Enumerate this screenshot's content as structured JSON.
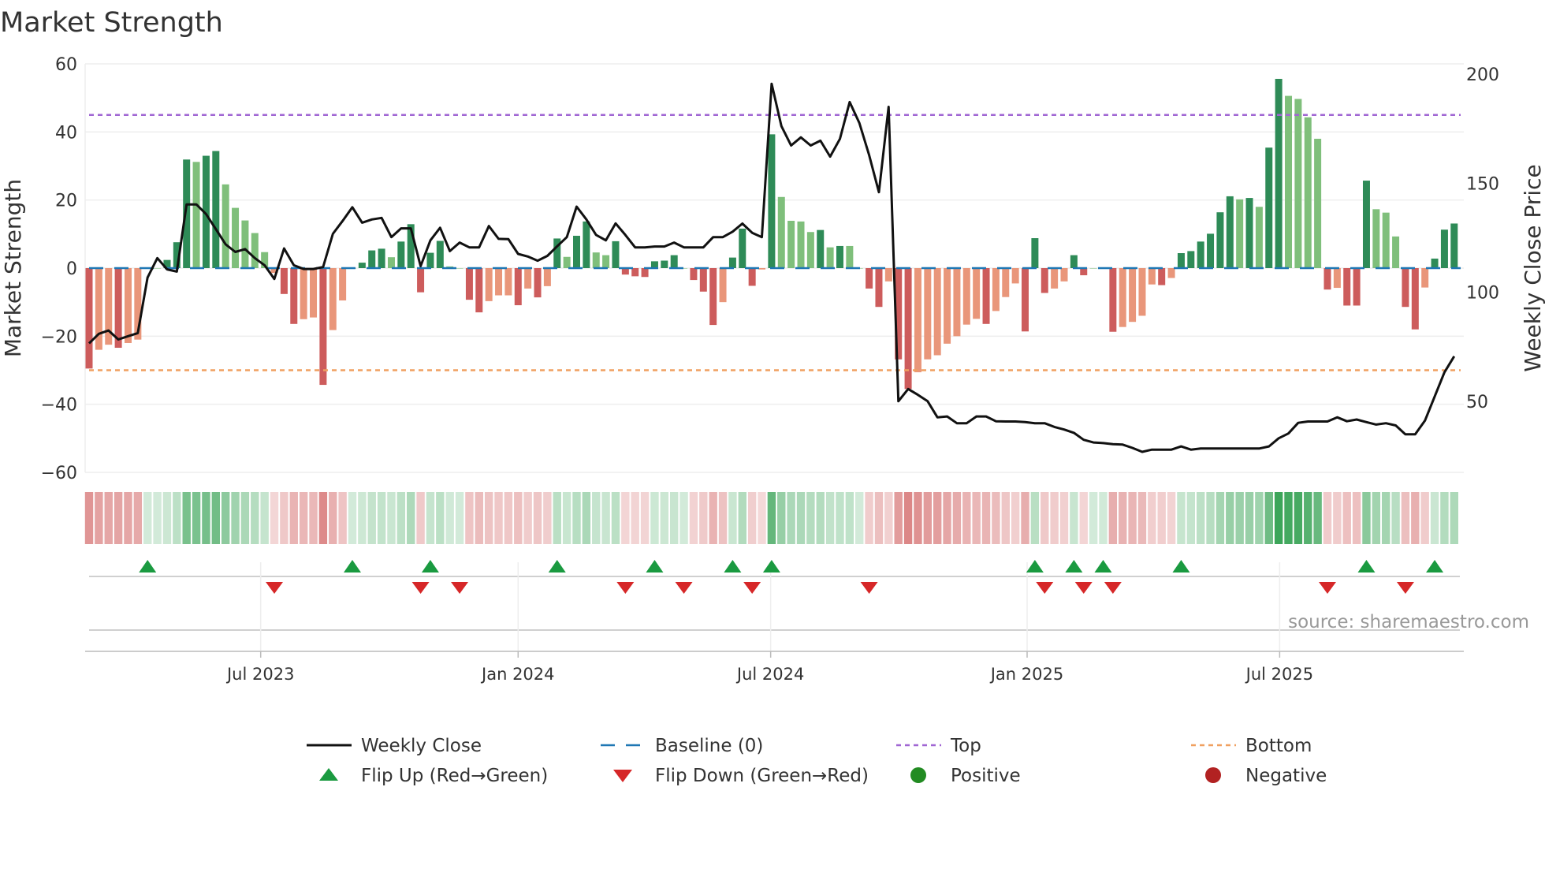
{
  "chart_data": {
    "type": "bar",
    "title": "Market Strength",
    "ylabel": "Market Strength",
    "y2label": "Weekly Close Price",
    "ylim": [
      -60,
      60
    ],
    "y2lim": [
      17.5,
      204.7
    ],
    "yticks": [
      60,
      40,
      20,
      0,
      -20,
      -40,
      -60
    ],
    "yticklabels": [
      "60",
      "40",
      "20",
      "0",
      "−20",
      "−40",
      "−60"
    ],
    "y2ticks": [
      200,
      150,
      100,
      50
    ],
    "y2ticklabels": [
      "200",
      "150",
      "100",
      "50"
    ],
    "x_unit": "week index",
    "xticks": [
      17.6,
      44.0,
      69.9,
      96.2,
      122.1
    ],
    "xticklabels": [
      "Jul 2023",
      "Jan 2024",
      "Jul 2024",
      "Jan 2025",
      "Jul 2025"
    ],
    "grid": true,
    "strength": [
      -29.5,
      -24,
      -22.5,
      -23.4,
      -22,
      -21,
      0,
      0,
      2.4,
      7.6,
      31.9,
      31.2,
      33,
      34.4,
      24.6,
      17.7,
      14,
      10.3,
      4.7,
      -1.4,
      -7.6,
      -16.4,
      -15,
      -14.5,
      -34.3,
      -18.2,
      -9.5,
      0,
      1.6,
      5.2,
      5.7,
      3.2,
      7.8,
      12.9,
      -7.1,
      4.5,
      8,
      0.5,
      0,
      -9.3,
      -13,
      -9.7,
      -8,
      -8,
      -10.9,
      -6,
      -8.6,
      -5.3,
      8.7,
      3.3,
      9.5,
      13.7,
      4.6,
      3.8,
      7.9,
      -1.9,
      -2.4,
      -2.6,
      2,
      2.2,
      3.8,
      0,
      -3.5,
      -6.9,
      -16.7,
      -10,
      3.1,
      11.6,
      -5.2,
      -0.4,
      39.3,
      20.9,
      13.9,
      13.7,
      10.6,
      11.2,
      6.1,
      6.5,
      6.5,
      0,
      -6,
      -11.4,
      -3.9,
      -26.8,
      -35.5,
      -30.6,
      -26.8,
      -25.6,
      -22.2,
      -20,
      -16.6,
      -14.9,
      -16.4,
      -12.6,
      -8.5,
      -4.5,
      -18.6,
      8.8,
      -7.3,
      -6,
      -3.9,
      3.8,
      -2.1,
      0,
      0.2,
      -18.7,
      -17.3,
      -15.8,
      -14,
      -4.8,
      -5,
      -2.9,
      4.4,
      5,
      7.8,
      10.1,
      16.4,
      21.1,
      20.2,
      20.6,
      18,
      35.4,
      55.6,
      50.6,
      49.7,
      44.3,
      38,
      -6.3,
      -5.8,
      -11,
      -11,
      25.7,
      17.3,
      16.3,
      9.3,
      -11.4,
      -18,
      -5.7,
      2.8,
      11.3,
      13.1
    ],
    "strong": [
      1,
      0,
      0,
      1,
      0,
      0,
      0,
      0,
      1,
      1,
      1,
      0,
      1,
      1,
      0,
      0,
      0,
      0,
      0,
      0,
      1,
      1,
      0,
      0,
      1,
      0,
      0,
      0,
      1,
      1,
      1,
      0,
      1,
      1,
      1,
      1,
      1,
      0,
      0,
      1,
      1,
      0,
      0,
      0,
      1,
      0,
      1,
      0,
      1,
      0,
      1,
      1,
      0,
      0,
      1,
      1,
      1,
      1,
      1,
      1,
      1,
      0,
      1,
      1,
      1,
      0,
      1,
      1,
      1,
      0,
      1,
      0,
      0,
      0,
      0,
      1,
      0,
      1,
      0,
      0,
      1,
      1,
      0,
      1,
      1,
      0,
      0,
      0,
      0,
      0,
      0,
      0,
      1,
      0,
      0,
      0,
      1,
      1,
      1,
      0,
      0,
      1,
      1,
      0,
      0,
      1,
      0,
      0,
      0,
      0,
      1,
      0,
      1,
      1,
      1,
      1,
      1,
      1,
      0,
      1,
      0,
      1,
      1,
      0,
      0,
      0,
      0,
      1,
      0,
      1,
      1,
      1,
      0,
      0,
      0,
      1,
      1,
      0,
      1,
      1,
      1
    ],
    "weekly_close": [
      76.6,
      81,
      82.5,
      78.4,
      79.9,
      81.3,
      106.8,
      115.7,
      110.5,
      109.5,
      140.3,
      140.3,
      135.9,
      129,
      122,
      118.5,
      119.8,
      115.7,
      112.4,
      106.1,
      120.1,
      112.4,
      110.7,
      110.7,
      111.6,
      126.8,
      132.7,
      139,
      131.9,
      133.4,
      134.1,
      125.3,
      129.3,
      129.3,
      112,
      123.8,
      129.6,
      118.9,
      122.8,
      120.6,
      120.6,
      130.4,
      124.5,
      124.4,
      117.6,
      116.4,
      114.5,
      116.7,
      121.1,
      125.3,
      139.3,
      133.4,
      126.3,
      123.8,
      131.6,
      126.3,
      120.6,
      120.6,
      121,
      121,
      122.8,
      120.6,
      120.6,
      120.6,
      125.3,
      125.3,
      127.8,
      131.5,
      127.3,
      125.3,
      195.6,
      176.2,
      167.3,
      171,
      167.3,
      169.5,
      162.2,
      170.3,
      187.2,
      177.6,
      162.9,
      145.9,
      185,
      50.1,
      55.7,
      53,
      50.1,
      42.7,
      43.1,
      40,
      40,
      43.1,
      43.1,
      40.9,
      40.8,
      40.8,
      40.5,
      40,
      40,
      38.3,
      37.1,
      35.6,
      32.4,
      31.2,
      30.9,
      30.4,
      30.2,
      28.7,
      26.9,
      27.9,
      27.9,
      27.9,
      29.4,
      27.9,
      28.4,
      28.4,
      28.4,
      28.4,
      28.4,
      28.4,
      28.4,
      29.4,
      33.1,
      35.3,
      40.2,
      40.8,
      40.8,
      40.8,
      42.7,
      40.9,
      41.7,
      40.5,
      39.4,
      40,
      39,
      34.9,
      34.9,
      41.2,
      52.3,
      63.3,
      70.7
    ],
    "top_level": 45,
    "bottom_level": -30,
    "baseline": 0,
    "flip_up_weeks": [
      6,
      27,
      35,
      48,
      58,
      66,
      70,
      97,
      101,
      104,
      112,
      131,
      138
    ],
    "flip_down_weeks": [
      19,
      34,
      38,
      55,
      61,
      68,
      80,
      98,
      102,
      105,
      127,
      135
    ],
    "legend_placement": "bottom-center",
    "legend": [
      {
        "key": "weekly_close",
        "label": "Weekly Close"
      },
      {
        "key": "baseline",
        "label": "Baseline (0)"
      },
      {
        "key": "top",
        "label": "Top"
      },
      {
        "key": "bottom",
        "label": "Bottom"
      },
      {
        "key": "flip_up",
        "label": "Flip Up (Red→Green)"
      },
      {
        "key": "flip_down",
        "label": "Flip Down (Green→Red)"
      },
      {
        "key": "positive",
        "label": "Positive"
      },
      {
        "key": "negative",
        "label": "Negative"
      }
    ],
    "source": "source: sharemaestro.com"
  },
  "colors": {
    "pos_strong": "#2e8b57",
    "pos_weak": "#7fbf7b",
    "neg_strong": "#cd5c5c",
    "neg_weak": "#e9967a",
    "line": "#111111",
    "baseline": "#1f77b4",
    "top": "#a066d3",
    "bottom": "#f0a060",
    "flip_up": "#1a9a40",
    "flip_down": "#d62728",
    "positive": "#228b22",
    "negative": "#b22222"
  }
}
